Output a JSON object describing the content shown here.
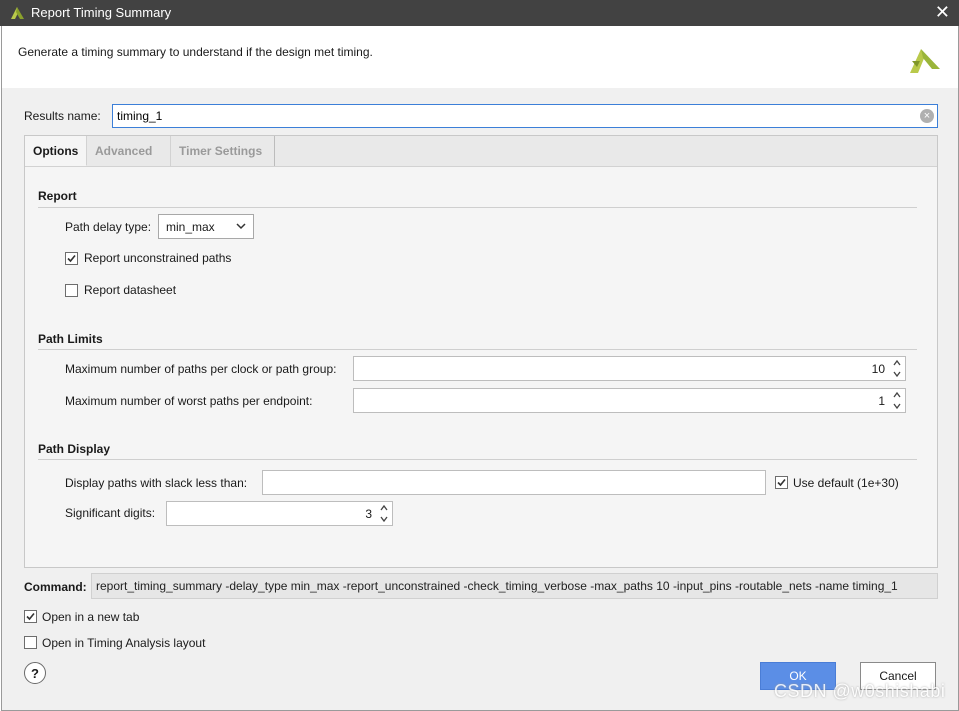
{
  "window": {
    "title": "Report Timing Summary",
    "close_glyph": "✕"
  },
  "description": "Generate a timing summary to understand if the design met timing.",
  "results": {
    "label": "Results name:",
    "value": "timing_1"
  },
  "tabs": [
    {
      "label": "Options",
      "active": true
    },
    {
      "label": "Advanced",
      "active": false
    },
    {
      "label": "Timer Settings",
      "active": false
    }
  ],
  "report": {
    "title": "Report",
    "path_delay_label": "Path delay type:",
    "path_delay_value": "min_max",
    "unconstrained_label": "Report unconstrained paths",
    "unconstrained_checked": true,
    "datasheet_label": "Report datasheet",
    "datasheet_checked": false
  },
  "path_limits": {
    "title": "Path Limits",
    "max_paths_label": "Maximum number of paths per clock or path group:",
    "max_paths_value": "10",
    "worst_paths_label": "Maximum number of worst paths per endpoint:",
    "worst_paths_value": "1"
  },
  "path_display": {
    "title": "Path Display",
    "slack_label": "Display paths with slack less than:",
    "slack_value": "",
    "use_default_label": "Use default (1e+30)",
    "use_default_checked": true,
    "sig_digits_label": "Significant digits:",
    "sig_digits_value": "3"
  },
  "command": {
    "label": "Command:",
    "text": "report_timing_summary -delay_type min_max -report_unconstrained -check_timing_verbose -max_paths 10 -input_pins -routable_nets -name timing_1"
  },
  "options": {
    "new_tab_label": "Open in a new tab",
    "new_tab_checked": true,
    "timing_layout_label": "Open in Timing Analysis layout",
    "timing_layout_checked": false
  },
  "buttons": {
    "help": "?",
    "ok": "OK",
    "cancel": "Cancel"
  },
  "watermark": "CSDN @w0shishabi",
  "colors": {
    "titlebar": "#424242",
    "accent": "#5b8ee6",
    "logo": "#9ab53a",
    "focus": "#3c7fd8"
  },
  "icons": {
    "app": "vivado-logo-icon",
    "close": "close-icon",
    "clear": "clear-input-icon",
    "help": "help-icon"
  }
}
